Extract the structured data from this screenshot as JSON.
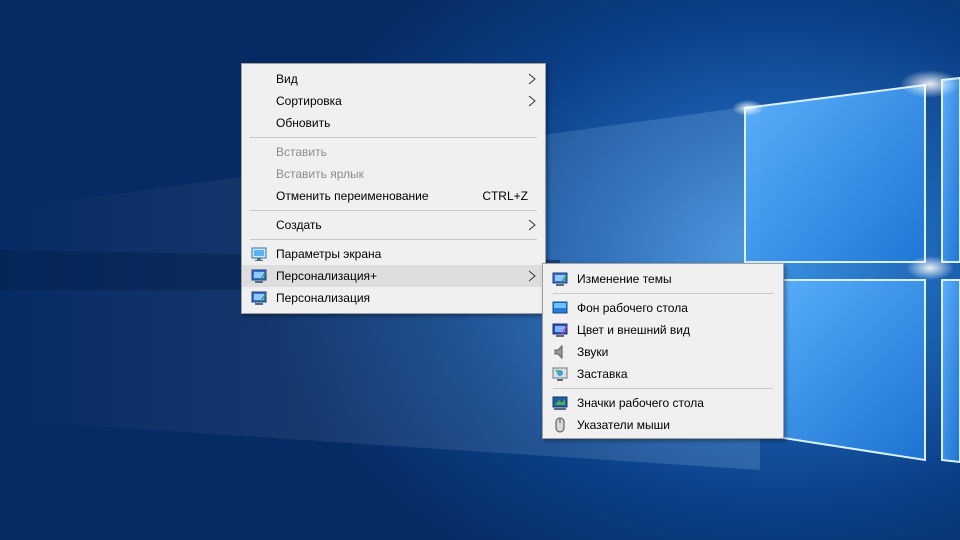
{
  "desktop": {
    "background_colors": {
      "dark": "#062a63",
      "mid": "#1a5fb0",
      "light": "#3a8fe0"
    }
  },
  "context_menu": {
    "items": [
      {
        "label": "Вид",
        "has_submenu": true
      },
      {
        "label": "Сортировка",
        "has_submenu": true
      },
      {
        "label": "Обновить"
      },
      {
        "label": "Вставить",
        "disabled": true
      },
      {
        "label": "Вставить ярлык",
        "disabled": true
      },
      {
        "label": "Отменить переименование",
        "shortcut": "CTRL+Z"
      },
      {
        "label": "Создать",
        "has_submenu": true
      },
      {
        "label": "Параметры экрана",
        "icon": "display-settings-icon"
      },
      {
        "label": "Персонализация+",
        "icon": "personalization-icon",
        "has_submenu": true,
        "highlighted": true
      },
      {
        "label": "Персонализация",
        "icon": "personalization-icon"
      }
    ]
  },
  "submenu": {
    "items": [
      {
        "label": "Изменение темы",
        "icon": "theme-icon"
      },
      {
        "label": "Фон рабочего стола",
        "icon": "desktop-background-icon"
      },
      {
        "label": "Цвет и внешний вид",
        "icon": "color-appearance-icon"
      },
      {
        "label": "Звуки",
        "icon": "speaker-icon"
      },
      {
        "label": "Заставка",
        "icon": "screensaver-icon"
      },
      {
        "label": "Значки рабочего стола",
        "icon": "desktop-icons-icon"
      },
      {
        "label": "Указатели мыши",
        "icon": "mouse-icon"
      }
    ]
  }
}
